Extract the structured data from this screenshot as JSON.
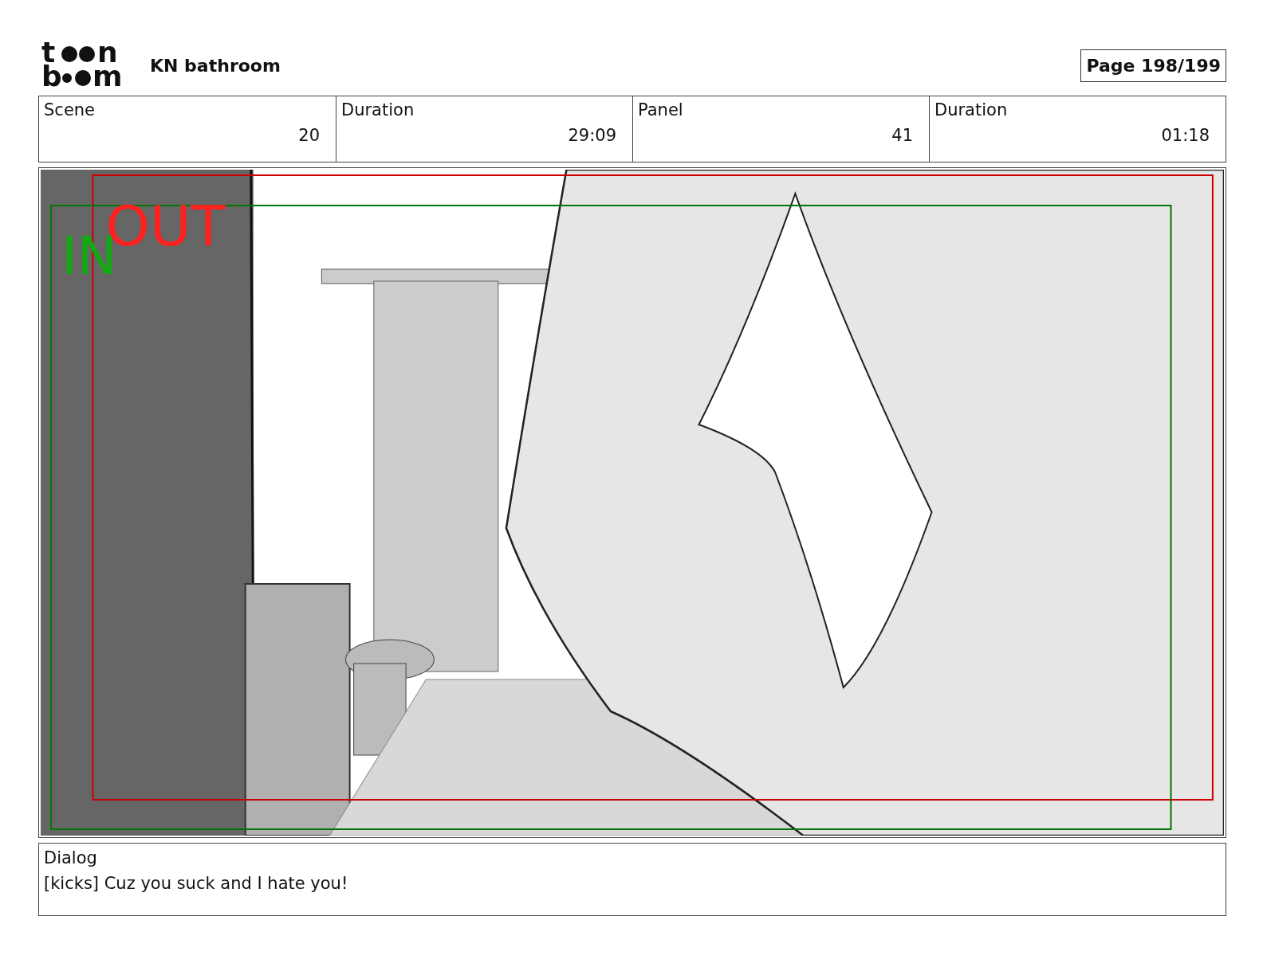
{
  "header": {
    "logo": {
      "line_1": [
        "t",
        "n"
      ],
      "line_2": [
        "b",
        "m"
      ]
    },
    "title": "KN bathroom",
    "page": "Page 198/199"
  },
  "info": [
    {
      "label": "Scene",
      "value": "20"
    },
    {
      "label": "Duration",
      "value": "29:09"
    },
    {
      "label": "Panel",
      "value": "41"
    },
    {
      "label": "Duration",
      "value": "01:18"
    }
  ],
  "panel": {
    "in_label": "IN",
    "out_label": "OUT"
  },
  "dialog": {
    "label": "Dialog",
    "text": "[kicks] Cuz you suck and I hate you!"
  }
}
